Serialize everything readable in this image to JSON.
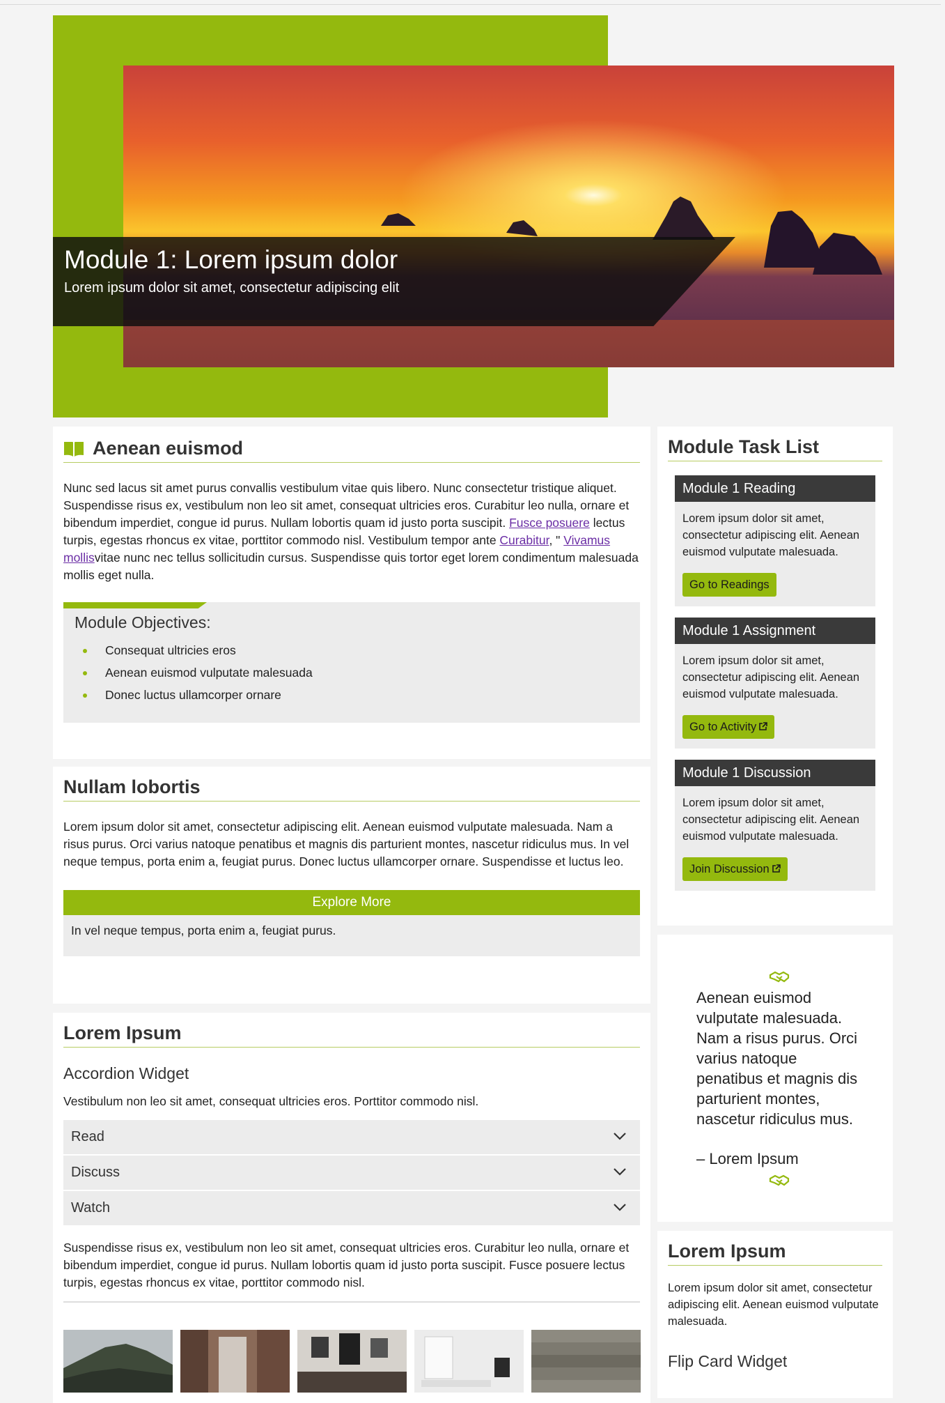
{
  "hero": {
    "title": "Module 1: Lorem ipsum dolor",
    "subtitle": "Lorem ipsum dolor sit amet, consectetur adipiscing elit"
  },
  "intro": {
    "heading": "Aenean euismod",
    "p_before_link1": "Nunc sed lacus sit amet purus convallis vestibulum vitae quis libero. Nunc consectetur tristique aliquet. Suspendisse risus ex, vestibulum non leo sit amet, consequat ultricies eros. Curabitur leo nulla, ornare et bibendum imperdiet, congue id purus. Nullam lobortis quam id justo porta suscipit. ",
    "link1": "Fusce posuere",
    "p_after_link1": " lectus turpis, egestas rhoncus ex vitae, porttitor commodo nisl. Vestibulum tempor ante ",
    "link2": "Curabitur",
    "p_between": ", \" ",
    "link3": "Vivamus mollis",
    "p_end": "vitae nunc nec tellus sollicitudin cursus. Suspendisse quis tortor eget lorem condimentum malesuada mollis eget nulla.",
    "objectives_title": "Module Objectives:",
    "objectives": [
      "Consequat ultricies eros",
      "Aenean euismod vulputate malesuada",
      "Donec luctus ullamcorper ornare"
    ]
  },
  "section2": {
    "heading": "Nullam lobortis",
    "paragraph": "Lorem ipsum dolor sit amet, consectetur adipiscing elit. Aenean euismod vulputate malesuada. Nam a risus purus. Orci varius natoque penatibus et magnis dis parturient montes, nascetur ridiculus mus. In vel neque tempus, porta enim a, feugiat purus. Donec luctus ullamcorper ornare. Suspendisse et luctus leo.",
    "explore_label": "Explore More",
    "explore_text": "In vel neque tempus, porta enim a, feugiat purus."
  },
  "section3": {
    "heading": "Lorem Ipsum",
    "accordion_title": "Accordion Widget",
    "accordion_intro": "Vestibulum non leo sit amet, consequat ultricies eros. Porttitor commodo nisl.",
    "accordion_items": [
      "Read",
      "Discuss",
      "Watch"
    ],
    "after_text": "Suspendisse risus ex, vestibulum non leo sit amet, consequat ultricies eros. Curabitur leo nulla, ornare et bibendum imperdiet, congue id purus. Nullam lobortis quam id justo porta suscipit. Fusce posuere lectus turpis, egestas rhoncus ex vitae, porttitor commodo nisl."
  },
  "tasklist": {
    "heading": "Module Task List",
    "tasks": [
      {
        "title": "Module 1 Reading",
        "text": "Lorem ipsum dolor sit amet, consectetur adipiscing elit. Aenean euismod vulputate malesuada.",
        "button": "Go to Readings"
      },
      {
        "title": "Module 1 Assignment",
        "text": "Lorem ipsum dolor sit amet, consectetur adipiscing elit. Aenean euismod vulputate malesuada.",
        "button": "Go to Activity"
      },
      {
        "title": "Module 1 Discussion",
        "text": "Lorem ipsum dolor sit amet, consectetur adipiscing elit. Aenean euismod vulputate malesuada.",
        "button": "Join Discussion"
      }
    ]
  },
  "quote": {
    "text": "Aenean euismod vulputate malesuada. Nam a risus purus. Orci varius natoque penatibus et magnis dis parturient montes, nascetur ridiculus mus.",
    "author": "– Lorem Ipsum"
  },
  "sidebar2": {
    "heading": "Lorem Ipsum",
    "text": "Lorem ipsum dolor sit amet, consectetur adipiscing elit. Aenean euismod vulputate malesuada.",
    "widget_title": "Flip Card Widget"
  },
  "colors": {
    "accent": "#94b90e",
    "dark": "#3a3a3a",
    "link": "#6b2ea5"
  },
  "icons": [
    "book-icon",
    "chevron-down-icon",
    "external-link-icon",
    "handshake-icon"
  ]
}
